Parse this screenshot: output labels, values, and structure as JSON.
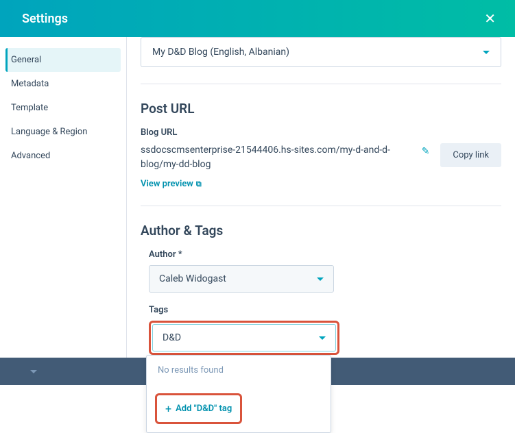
{
  "header": {
    "title": "Settings"
  },
  "sidebar": {
    "items": [
      {
        "label": "General"
      },
      {
        "label": "Metadata"
      },
      {
        "label": "Template"
      },
      {
        "label": "Language & Region"
      },
      {
        "label": "Advanced"
      }
    ]
  },
  "blogSelect": {
    "value": "My D&D Blog (English, Albanian)"
  },
  "postUrl": {
    "sectionTitle": "Post URL",
    "label": "Blog URL",
    "url": "ssdocscmsenterprise-21544406.hs-sites.com/my-d-and-d-blog/my-dd-blog",
    "previewLabel": "View preview",
    "copyLabel": "Copy link"
  },
  "authorTags": {
    "sectionTitle": "Author & Tags",
    "authorLabel": "Author *",
    "authorValue": "Caleb Widogast",
    "tagsLabel": "Tags",
    "tagsValue": "D&D",
    "noResults": "No results found",
    "addTagLabel": "Add \"D&D\" tag"
  }
}
